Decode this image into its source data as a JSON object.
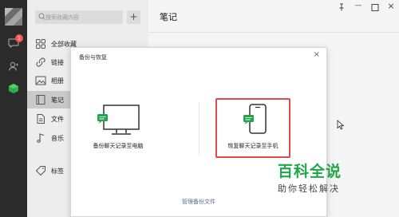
{
  "sidebar": {
    "badge_count": "1"
  },
  "list_panel": {
    "search_placeholder": "搜索收藏内容",
    "add_label": "+",
    "items": [
      {
        "label": "全部收藏",
        "icon": "grid-icon"
      },
      {
        "label": "链接",
        "icon": "link-icon"
      },
      {
        "label": "相册",
        "icon": "image-icon"
      },
      {
        "label": "笔记",
        "icon": "note-icon",
        "active": true
      },
      {
        "label": "文件",
        "icon": "file-icon"
      },
      {
        "label": "音乐",
        "icon": "music-icon"
      },
      {
        "label": "标签",
        "icon": "tag-icon"
      }
    ]
  },
  "main": {
    "title": "笔记"
  },
  "dialog": {
    "title": "备份与恢复",
    "close_label": "×",
    "option_backup_label": "备份聊天记录至电脑",
    "option_restore_label": "恢复聊天记录至手机",
    "manage_label": "管理备份文件"
  },
  "watermark": {
    "main": "百科全说",
    "sub": "助你轻松解决"
  },
  "colors": {
    "accent_green": "#1fa64a",
    "badge_red": "#fa5151",
    "highlight_red": "#e04b4b",
    "link_blue": "#576b95"
  }
}
